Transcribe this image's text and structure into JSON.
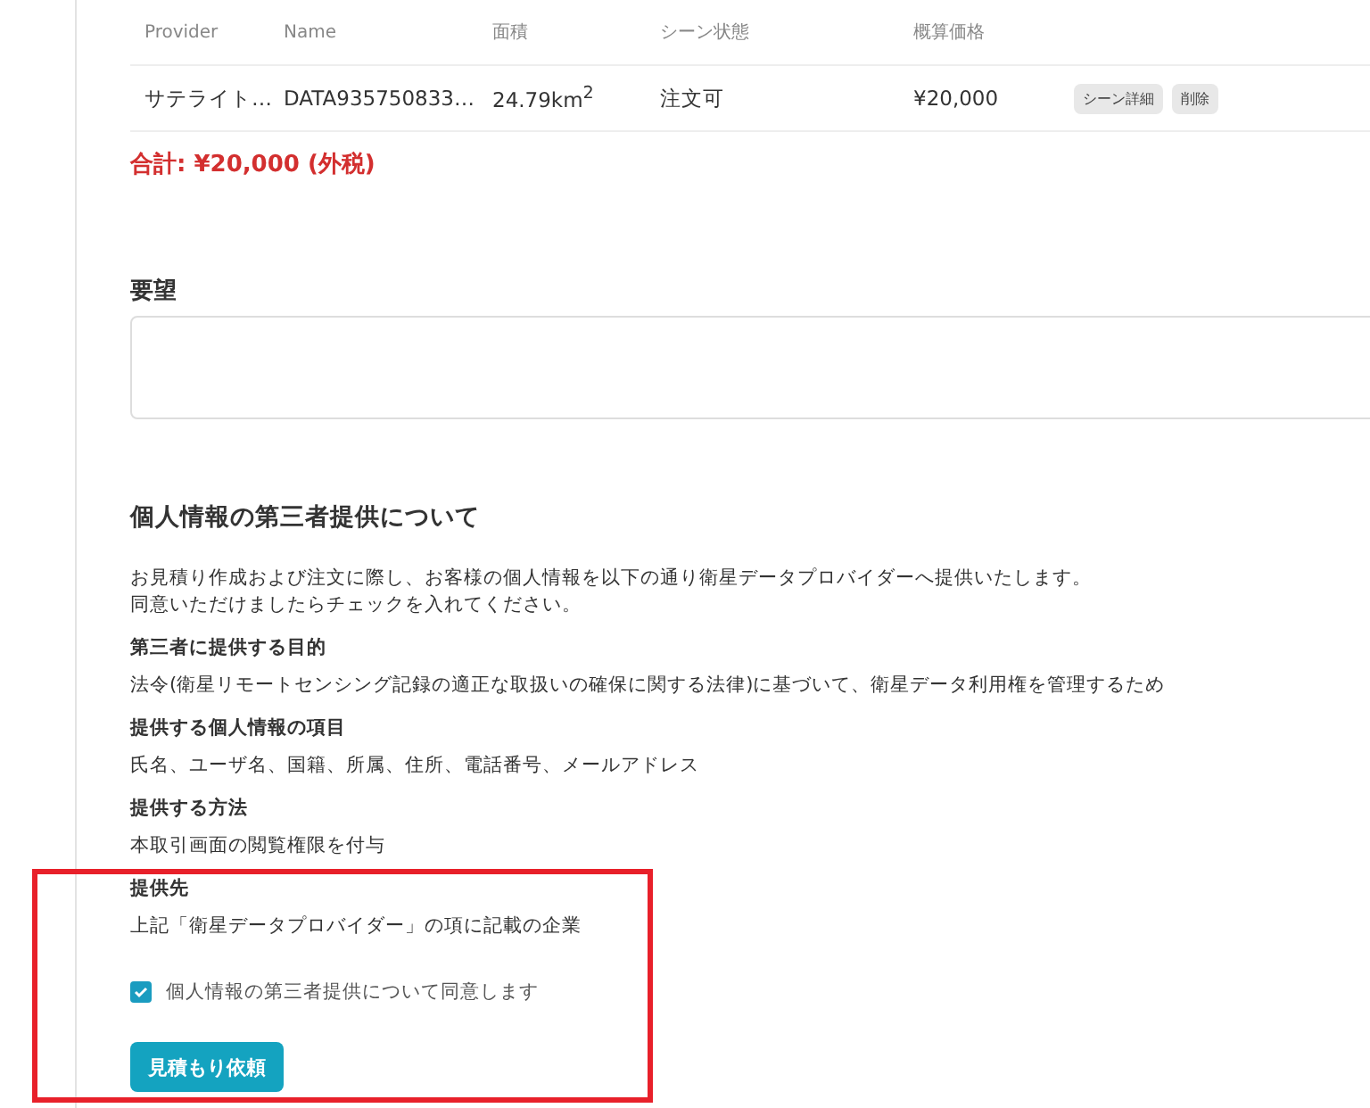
{
  "table": {
    "columns": [
      "Provider",
      "Name",
      "面積",
      "シーン状態",
      "概算価格"
    ],
    "rows": [
      {
        "provider": "サテライト…",
        "name": "DATA935750833…",
        "area": "24.79km$^{2}$",
        "status": "注文可",
        "price": "¥20,000",
        "actions": [
          "シーン詳細",
          "削除"
        ]
      }
    ]
  },
  "total": "合計: ¥20,000 (外税)",
  "request": {
    "label": "要望"
  },
  "privacy": {
    "title": "個人情報の第三者提供について",
    "intro": [
      "お見積り作成および注文に際し、お客様の個人情報を以下の通り衛星データプロバイダーへ提供いたします。",
      "同意いただけましたらチェックを入れてください。"
    ],
    "items": [
      {
        "heading": "第三者に提供する目的",
        "body": "法令(衛星リモートセンシング記録の適正な取扱いの確保に関する法律)に基づいて、衛星データ利用権を管理するため"
      },
      {
        "heading": "提供する個人情報の項目",
        "body": "氏名、ユーザ名、国籍、所属、住所、電話番号、メールアドレス"
      },
      {
        "heading": "提供する方法",
        "body": "本取引画面の閲覧権限を付与"
      },
      {
        "heading": "提供先",
        "body": "上記「衛星データプロバイダー」の項に記載の企業"
      }
    ],
    "consent": {
      "label": "個人情報の第三者提供について同意します",
      "checked": true
    }
  },
  "submit": "見積もり依頼"
}
